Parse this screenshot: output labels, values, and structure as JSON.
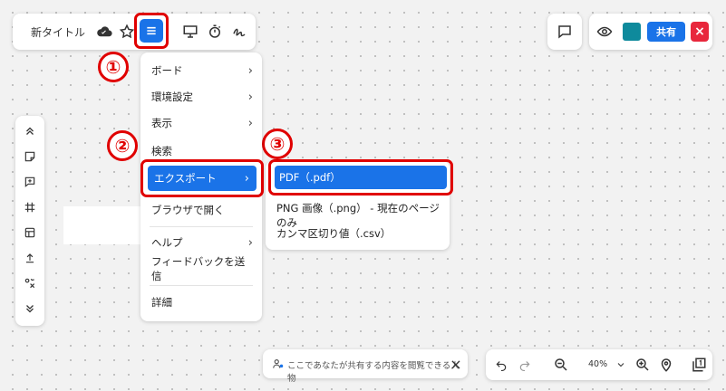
{
  "topbar": {
    "title": "新タイトル",
    "icons": [
      "cloud-done-icon",
      "star-icon",
      "menu-icon",
      "present-icon",
      "timer-icon",
      "signature-icon"
    ]
  },
  "right_toolbar": {
    "share_label": "共有",
    "close_label": "×",
    "swatch_color": "#0e8a9c"
  },
  "annotations": {
    "step1": "①",
    "step2": "②",
    "step3": "③"
  },
  "main_menu": {
    "items": [
      {
        "label": "ボード",
        "chevron": "›"
      },
      {
        "label": "環境設定",
        "chevron": "›"
      },
      {
        "label": "表示",
        "chevron": "›"
      },
      {
        "label": "検索",
        "chevron": ""
      },
      {
        "label": "エクスポート",
        "chevron": "›"
      },
      {
        "label": "ブラウザで開く",
        "chevron": ""
      },
      {
        "label": "ヘルプ",
        "chevron": "›"
      },
      {
        "label": "フィードバックを送信",
        "chevron": ""
      },
      {
        "label": "詳細",
        "chevron": ""
      }
    ]
  },
  "export_submenu": {
    "items": [
      {
        "label": "PDF（.pdf）"
      },
      {
        "label": "PNG 画像（.png） - 現在のページのみ"
      },
      {
        "label": "カンマ区切り値（.csv）"
      }
    ]
  },
  "hint": {
    "text": "ここであなたが共有する内容を閲覧できる人物",
    "close": "×"
  },
  "zoom": {
    "level": "40%"
  },
  "colors": {
    "accent": "#1a73e8",
    "highlight_border": "#e00000",
    "close": "#e8273c"
  }
}
